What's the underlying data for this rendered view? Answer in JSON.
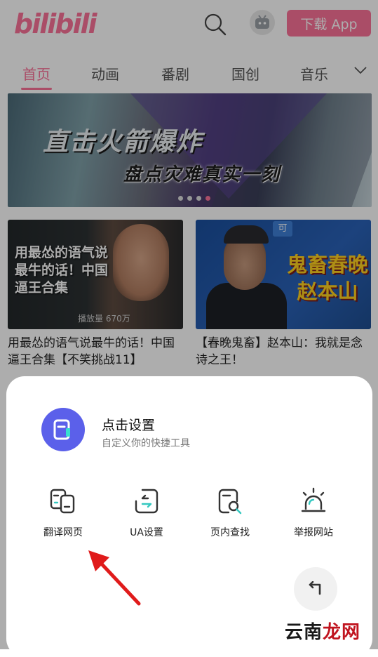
{
  "header": {
    "logo_text": "bilibili",
    "download_label": "下载 App"
  },
  "tabs": [
    {
      "label": "首页",
      "active": true
    },
    {
      "label": "动画",
      "active": false
    },
    {
      "label": "番剧",
      "active": false
    },
    {
      "label": "国创",
      "active": false
    },
    {
      "label": "音乐",
      "active": false
    }
  ],
  "banner": {
    "title": "直击火箭爆炸",
    "subtitle": "盘点灾难真实一刻",
    "pages": 4,
    "active_page": 4
  },
  "videos": [
    {
      "thumb_text": "用最怂的语气说最牛的话！中国逼王合集",
      "thumb_corner": "播放量 670万",
      "title": "用最怂的语气说最牛的话！中国逼王合集【不笑挑战11】"
    },
    {
      "thumb_badge": "可",
      "thumb_text": "鬼畜春晚赵本山",
      "title": "【春晚鬼畜】赵本山：我就是念诗之王！"
    }
  ],
  "sheet": {
    "title": "点击设置",
    "subtitle": "自定义你的快捷工具",
    "tools": [
      {
        "label": "翻译网页",
        "icon": "translate-icon"
      },
      {
        "label": "UA设置",
        "icon": "ua-icon"
      },
      {
        "label": "页内查找",
        "icon": "find-in-page-icon"
      },
      {
        "label": "举报网站",
        "icon": "alarm-icon"
      }
    ],
    "back_icon": "return-icon"
  },
  "watermark": {
    "part1": "云南",
    "part2": "龙网"
  },
  "colors": {
    "brand": "#fb7299",
    "accent": "#5b60ea",
    "annotation_arrow": "#e01b1b"
  }
}
